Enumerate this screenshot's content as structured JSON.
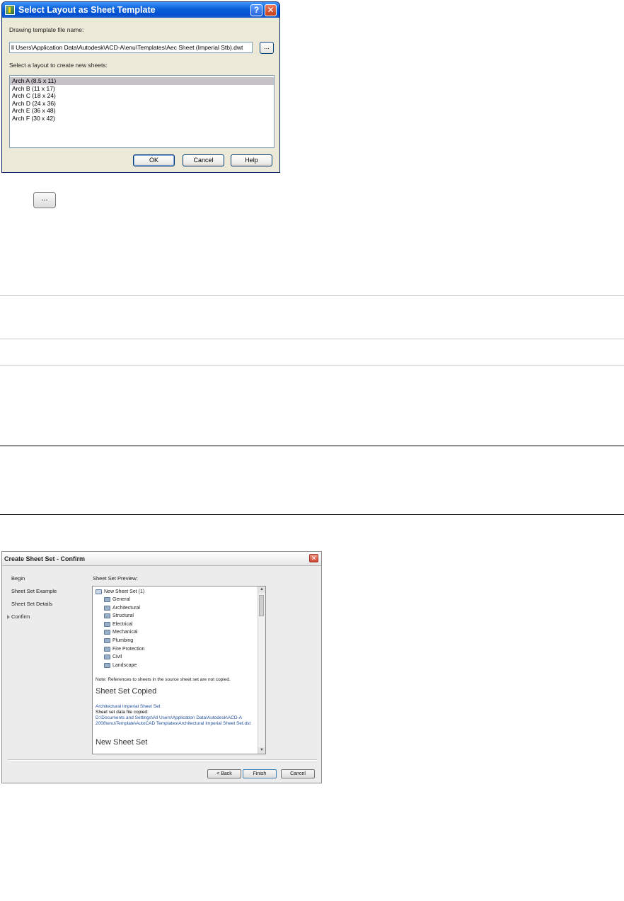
{
  "layout_dialog": {
    "title": "Select Layout as Sheet Template",
    "help_glyph": "?",
    "close_glyph": "✕",
    "file_label": "Drawing template file name:",
    "file_value": "ll Users\\Application Data\\Autodesk\\ACD-A\\enu\\Templates\\Aec Sheet (Imperial Stb).dwt",
    "browse_label": "...",
    "list_label": "Select a layout to create new sheets:",
    "layouts": [
      "Arch A (8.5 x 11)",
      "Arch B (11 x 17)",
      "Arch C (18 x 24)",
      "Arch D (24 x 36)",
      "Arch E (36 x 48)",
      "Arch F (30 x 42)"
    ],
    "selected_index": 0,
    "ok_label": "OK",
    "cancel_label": "Cancel",
    "help_label": "Help"
  },
  "browse_button_label": "...",
  "sheet_set_dialog": {
    "title": "Create Sheet Set - Confirm",
    "close_glyph": "✕",
    "steps": [
      "Begin",
      "Sheet Set Example",
      "Sheet Set Details",
      "Confirm"
    ],
    "current_step": "Confirm",
    "preview_label": "Sheet Set Preview:",
    "root": "New Sheet Set (1)",
    "subsets": [
      "General",
      "Architectural",
      "Structural",
      "Electrical",
      "Mechanical",
      "Plumbing",
      "Fire Protection",
      "Civil",
      "Landscape"
    ],
    "note": "Note: References to sheets in the source sheet set are not copied.",
    "copied_heading": "Sheet Set Copied",
    "copied_name": "Architectural Imperial Sheet Set",
    "data_file_label": "Sheet set data file copied:",
    "data_file_path": "D:\\Documents and Settings\\All Users\\Application Data\\Autodesk\\ACD-A 2008\\enu\\Template\\AutoCAD Templates\\Architectural Imperial Sheet Set.dst",
    "new_heading": "New Sheet Set",
    "back_label": "< Back",
    "finish_label": "Finish",
    "cancel_label": "Cancel"
  }
}
